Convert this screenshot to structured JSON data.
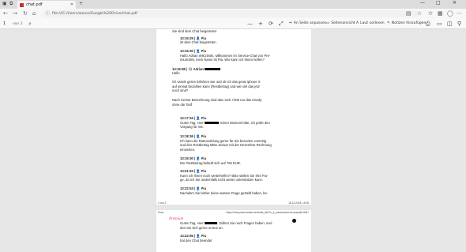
{
  "browser": {
    "tab_title": "chat.pdf",
    "tab_close": "✕",
    "address": "file:///C:/Users/weice/Google%20Drive/chat.pdf",
    "info_icon": "ⓘ",
    "win_min": "—",
    "win_max": "□",
    "win_close": "✕"
  },
  "pdf_toolbar": {
    "page_current": "1",
    "page_of": "von 2",
    "fit_page": "An Seite anpassen",
    "page_view": "Seitenansicht",
    "read_aloud": "Laut vorlesen",
    "add_notes": "Notizen hinzufügen"
  },
  "page1": {
    "lines": [
      {
        "id": "l0",
        "text": "Sie sind dem Chat beigetreten",
        "time": false
      },
      {
        "id": "l1",
        "text": "13:15:29 | 👤 Pia",
        "time": true
      },
      {
        "id": "l2",
        "text": "ist dem Chat beigetreten",
        "time": false
      },
      {
        "id": "l3",
        "text": "13:15:30 | 👤 Pia",
        "time": true
      },
      {
        "id": "l4",
        "text": "Hallo Adrian Wilczinski, willkommen im Service-Chat von Pre-",
        "time": false
      },
      {
        "id": "l5",
        "text": "miumSIM, mein Name ist Pia. Wie kann ich Ihnen helfen?",
        "time": false
      },
      {
        "id": "l6",
        "text": "13:15:58 | 🗨 Adrian",
        "time": true
      },
      {
        "id": "l7",
        "text": "Hallo",
        "time": false
      },
      {
        "id": "l8",
        "text": "ich würde gerne Erfahren wie und ob ich das gerat Iphone X",
        "time": false
      },
      {
        "id": "l9",
        "text": "auf einmal bezahlen kann (Restbetrag) und wie viel das jetz",
        "time": false
      },
      {
        "id": "l10",
        "text": "noch sind?",
        "time": false
      },
      {
        "id": "l11",
        "text": "Nach meiner Berechnung sind das noch 720€ nur das Handy",
        "time": false
      },
      {
        "id": "l12",
        "text": "ohne die Tarif",
        "time": false
      },
      {
        "id": "l13",
        "text": "13:17:34 | 👤 Pia",
        "time": true
      },
      {
        "id": "l14a",
        "text": "Guten Tag, Herr",
        "time": false
      },
      {
        "id": "l14b",
        "text": ". Einen Moment bitte, ich prüfe den",
        "time": false
      },
      {
        "id": "l15",
        "text": "Vorgang für Sie.",
        "time": false
      },
      {
        "id": "l16",
        "text": "13:18:36 | 👤 Pia",
        "time": true
      },
      {
        "id": "l17",
        "text": "Ich kann die Ratenzahlung gerne für Sie beenden vorzeitig",
        "time": false
      },
      {
        "id": "l18",
        "text": "und den Restbetrag Mitte Januar mit der Dezember Rechnung",
        "time": false
      },
      {
        "id": "l19",
        "text": "einziehen.",
        "time": false
      },
      {
        "id": "l20",
        "text": "13:19:30 | 👤 Pia",
        "time": true
      },
      {
        "id": "l21",
        "text": "Der Restbetrag beläuft sich auf 792 EUR.",
        "time": false
      },
      {
        "id": "l22",
        "text": "13:21:53 | 👤 Pia",
        "time": true
      },
      {
        "id": "l23",
        "text": "Kann ich Ihnen noch weiterhelfen? Bitte stellen Sie Ihre Fra-",
        "time": false
      },
      {
        "id": "l24",
        "text": "ge, da ich Sie andernfalls nicht weiter unterstützen kann.",
        "time": false
      },
      {
        "id": "l25",
        "text": "13:22:53 | 👤 Pia",
        "time": true
      },
      {
        "id": "l26",
        "text": "Nachdem Sie bisher keine weitere Frage gestellt haben, be-",
        "time": false
      }
    ],
    "footer_left": "1 von 2",
    "footer_right": "18.12.2018, 15:28"
  },
  "page2": {
    "header_left": "Chat",
    "header_right": "https://chat.premiumsim.de/chats_de/2/c_d_premiumsim.de.prepaid.html?",
    "brand": "Premium",
    "lines": [
      {
        "id": "m0a",
        "text": "Guten Tag, Herr",
        "time": false
      },
      {
        "id": "m0b",
        "text": ". Sollten Sie noch Fragen haben, mel-",
        "time": false
      },
      {
        "id": "m1",
        "text": "den Sie sich gerne erneut an.",
        "time": false
      },
      {
        "id": "m2",
        "text": "13:22:55 | 👤 Pia",
        "time": true
      },
      {
        "id": "m3",
        "text": "hat den Chat beendet",
        "time": false
      }
    ]
  }
}
